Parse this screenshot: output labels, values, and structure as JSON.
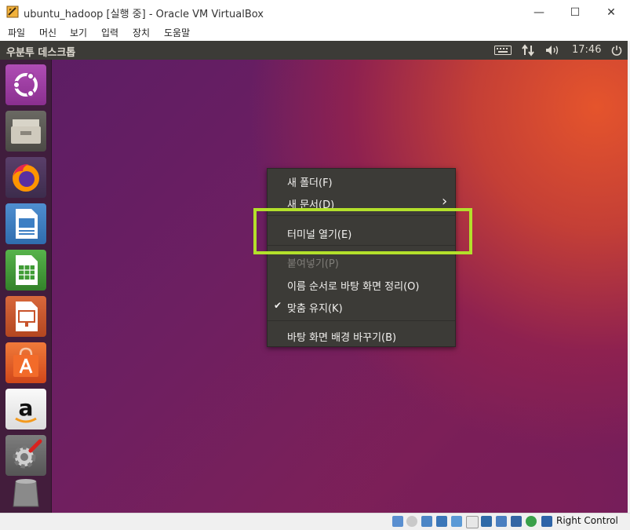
{
  "window": {
    "title": "ubuntu_hadoop [실행 중] - Oracle VM VirtualBox",
    "minimize": "—",
    "maximize": "☐",
    "close": "✕"
  },
  "menubar": {
    "items": [
      "파일",
      "머신",
      "보기",
      "입력",
      "장치",
      "도움말"
    ]
  },
  "topbar": {
    "title": "우분투 데스크톱",
    "clock": "17:46",
    "indicators": [
      "keyboard-icon",
      "network-icon",
      "volume-icon",
      "power-icon"
    ]
  },
  "launcher": {
    "items": [
      {
        "name": "ubuntu-dash-icon",
        "bg": "#9b3ea0"
      },
      {
        "name": "files-icon",
        "bg": "#5c5b56"
      },
      {
        "name": "firefox-icon",
        "bg": "#e66000"
      },
      {
        "name": "libreoffice-writer-icon",
        "bg": "#3d7fc4"
      },
      {
        "name": "libreoffice-calc-icon",
        "bg": "#3f9c35"
      },
      {
        "name": "libreoffice-impress-icon",
        "bg": "#c8532a"
      },
      {
        "name": "software-center-icon",
        "bg": "#e05a22"
      },
      {
        "name": "amazon-icon",
        "bg": "#f0f0f0"
      },
      {
        "name": "system-settings-icon",
        "bg": "#6f6f6f"
      },
      {
        "name": "trash-icon",
        "bg": "#7b7b7b"
      }
    ]
  },
  "context_menu": {
    "new_folder": "새 폴더(F)",
    "new_document": "새 문서(D)",
    "open_terminal": "터미널 열기(E)",
    "paste": "붙여넣기(P)",
    "arrange_by_name": "이름 순서로 바탕 화면 정리(O)",
    "keep_aligned": "맞춤 유지(K)",
    "change_background": "바탕 화면 배경 바꾸기(B)",
    "check_mark": "✔",
    "submenu_arrow": "›"
  },
  "statusbar": {
    "host_key": "Right Control"
  },
  "colors": {
    "highlight": "#b3e02b",
    "menu_bg": "#3c3b37"
  }
}
